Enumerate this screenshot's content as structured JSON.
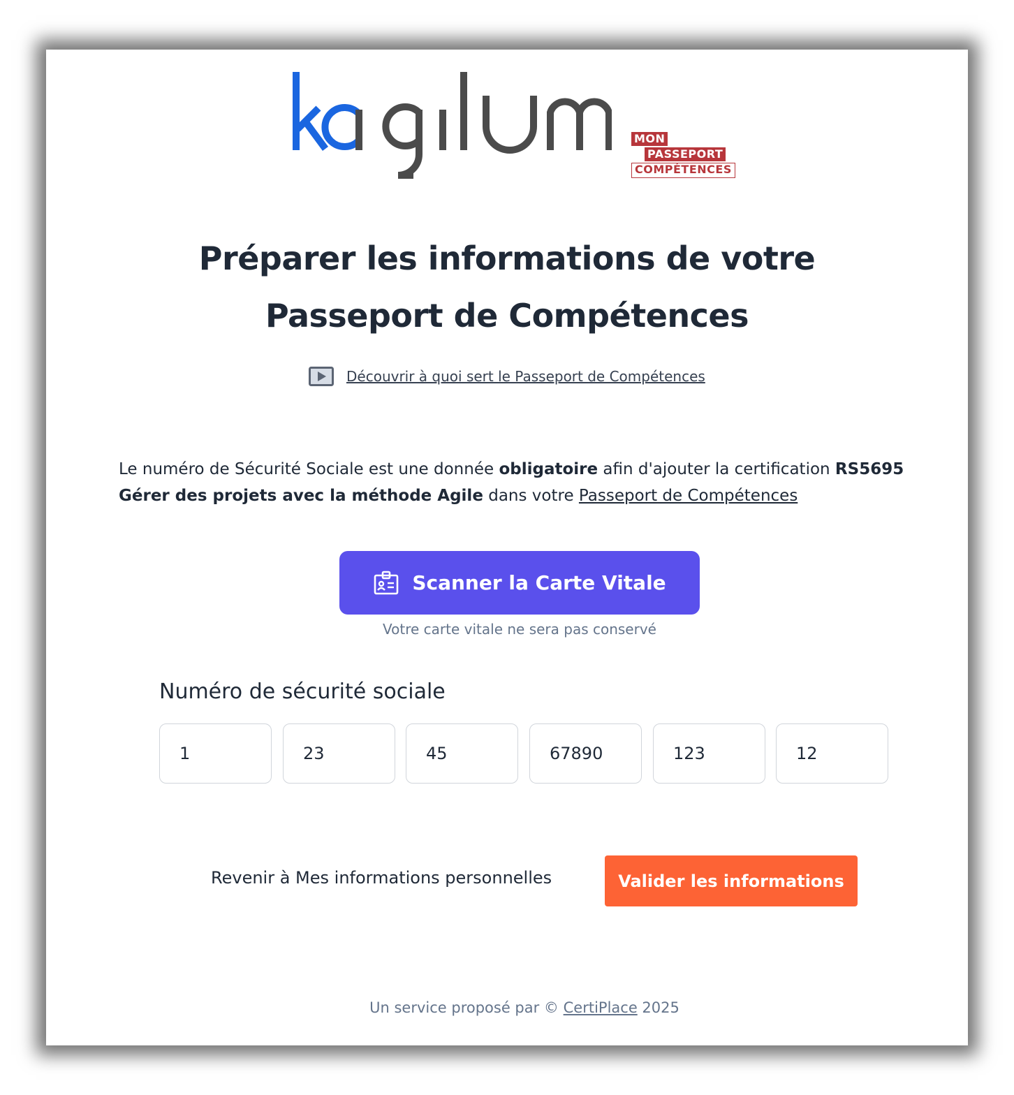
{
  "brand": {
    "logo_text": "kagilum",
    "logo_colors": {
      "blue": "#1a66e0",
      "gray": "#4b4b4b"
    },
    "partner_badge": {
      "line1": "MON",
      "line2": "PASSEPORT",
      "line3": "COMPÉTENCES",
      "color": "#b7363b"
    }
  },
  "header": {
    "title_line1": "Préparer les informations de votre",
    "title_line2": "Passeport de Compétences"
  },
  "video_link": {
    "icon": "play-video-icon",
    "label": "Découvrir à quoi sert le Passeport de Compétences"
  },
  "intro": {
    "part1": "Le numéro de Sécurité Sociale est une donnée ",
    "bold1": "obligatoire",
    "part2": " afin d'ajouter la certification ",
    "bold2": "RS5695 Gérer des projets avec la méthode Agile",
    "part3": " dans votre ",
    "link": "Passeport de Compétences"
  },
  "scan": {
    "icon": "id-card-icon",
    "label": "Scanner la Carte Vitale",
    "note": "Votre carte vitale ne sera pas conservé",
    "color": "#5a50ec"
  },
  "nss": {
    "label": "Numéro de sécurité sociale",
    "fields": [
      "1",
      "23",
      "45",
      "67890",
      "123",
      "12"
    ]
  },
  "actions": {
    "back_label": "Revenir à Mes informations personnelles",
    "validate_label": "Valider les informations",
    "validate_color": "#fd6335"
  },
  "footer": {
    "prefix": "Un service proposé par © ",
    "link": "CertiPlace",
    "suffix": " 2025"
  }
}
